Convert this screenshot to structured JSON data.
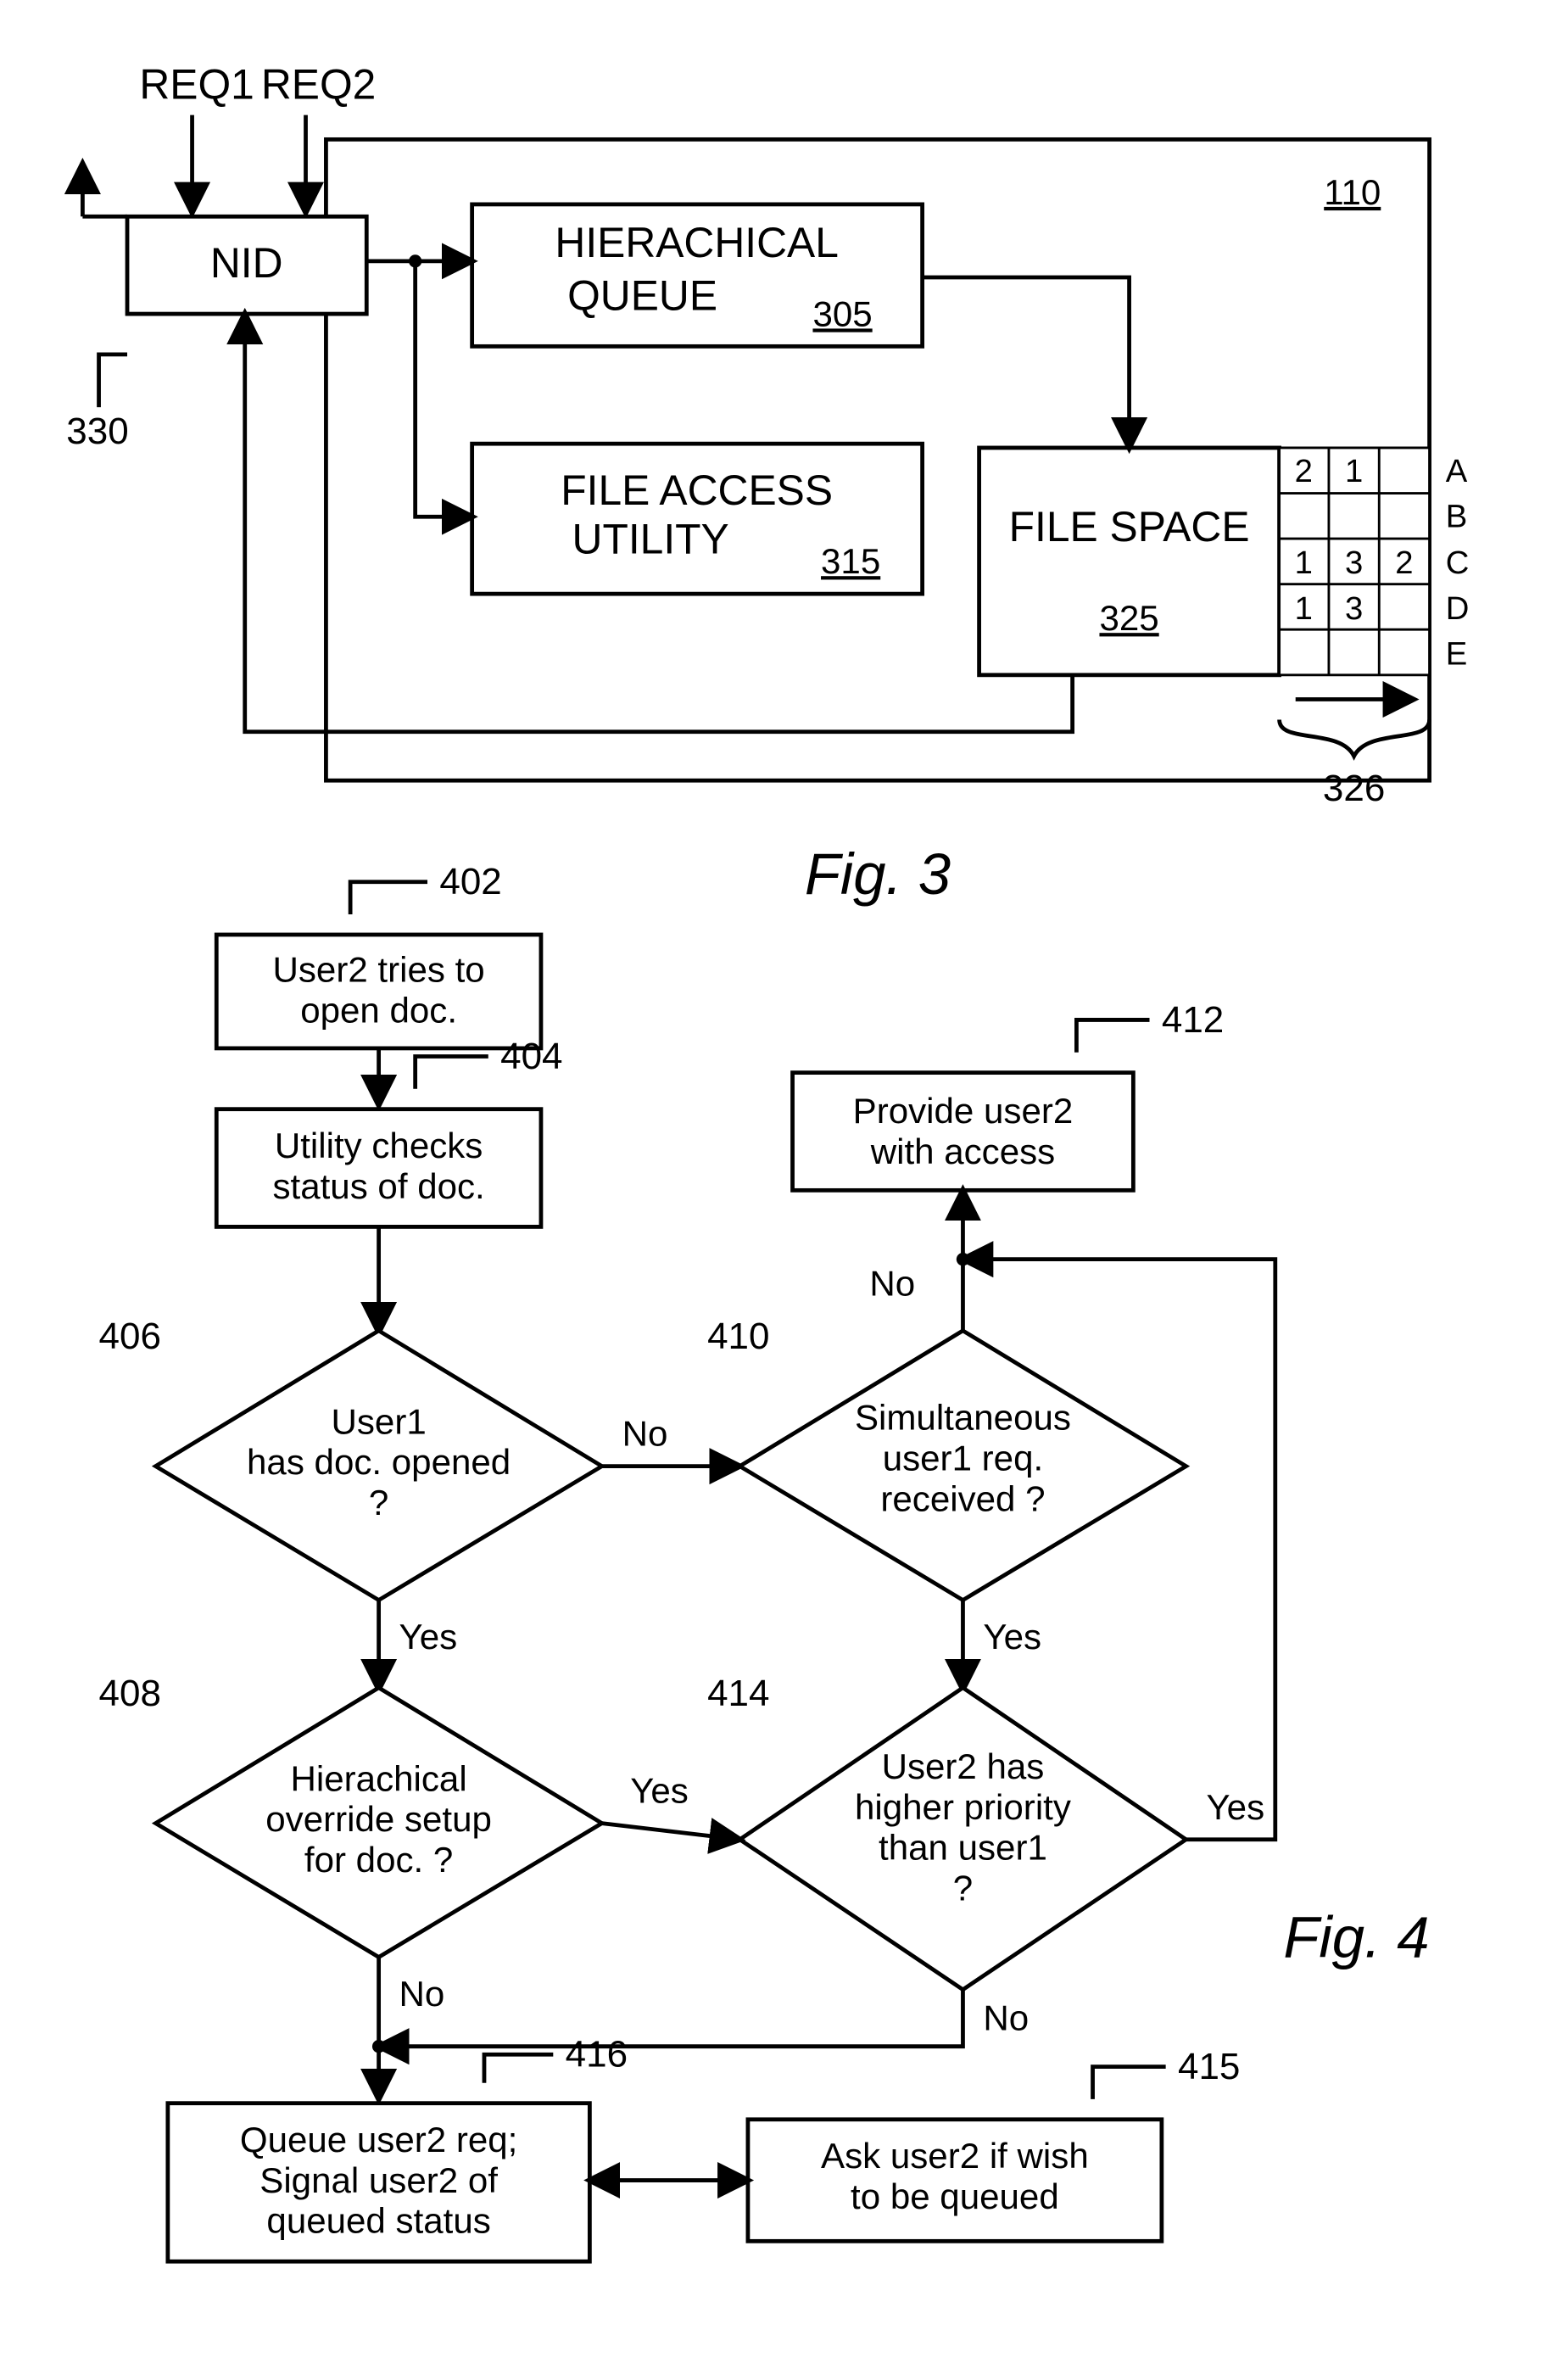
{
  "fig3": {
    "caption": "Fig.  3",
    "req1": "REQ1",
    "req2": "REQ2",
    "nid": "NID",
    "nid_ref": "330",
    "outer_ref": "110",
    "hq": {
      "title": "HIERACHICAL",
      "title2": "QUEUE",
      "ref": "305"
    },
    "fau": {
      "title": "FILE ACCESS",
      "title2": "UTILITY",
      "ref": "315"
    },
    "fs": {
      "title": "FILE SPACE",
      "ref": "325"
    },
    "grid_ref": "326",
    "rows": [
      "A",
      "B",
      "C",
      "D",
      "E"
    ],
    "cells": {
      "A": [
        "2",
        "1",
        ""
      ],
      "B": [
        "",
        "",
        ""
      ],
      "C": [
        "1",
        "3",
        "2"
      ],
      "D": [
        "1",
        "3",
        ""
      ],
      "E": [
        "",
        "",
        ""
      ]
    }
  },
  "fig4": {
    "caption": "Fig.  4",
    "n402": {
      "ref": "402",
      "l1": "User2 tries to",
      "l2": "open doc."
    },
    "n404": {
      "ref": "404",
      "l1": "Utility checks",
      "l2": "status of doc."
    },
    "n406": {
      "ref": "406",
      "l1": "User1",
      "l2": "has doc. opened",
      "l3": "?"
    },
    "n408": {
      "ref": "408",
      "l1": "Hierachical",
      "l2": "override setup",
      "l3": "for doc. ?"
    },
    "n410": {
      "ref": "410",
      "l1": "Simultaneous",
      "l2": "user1 req.",
      "l3": "received ?"
    },
    "n412": {
      "ref": "412",
      "l1": "Provide user2",
      "l2": "with access"
    },
    "n414": {
      "ref": "414",
      "l1": "User2 has",
      "l2": "higher priority",
      "l3": "than user1",
      "l4": "?"
    },
    "n415": {
      "ref": "415",
      "l1": "Ask user2 if wish",
      "l2": "to be queued"
    },
    "n416": {
      "ref": "416",
      "l1": "Queue user2 req;",
      "l2": "Signal user2 of",
      "l3": "queued status"
    },
    "yes": "Yes",
    "no": "No"
  }
}
